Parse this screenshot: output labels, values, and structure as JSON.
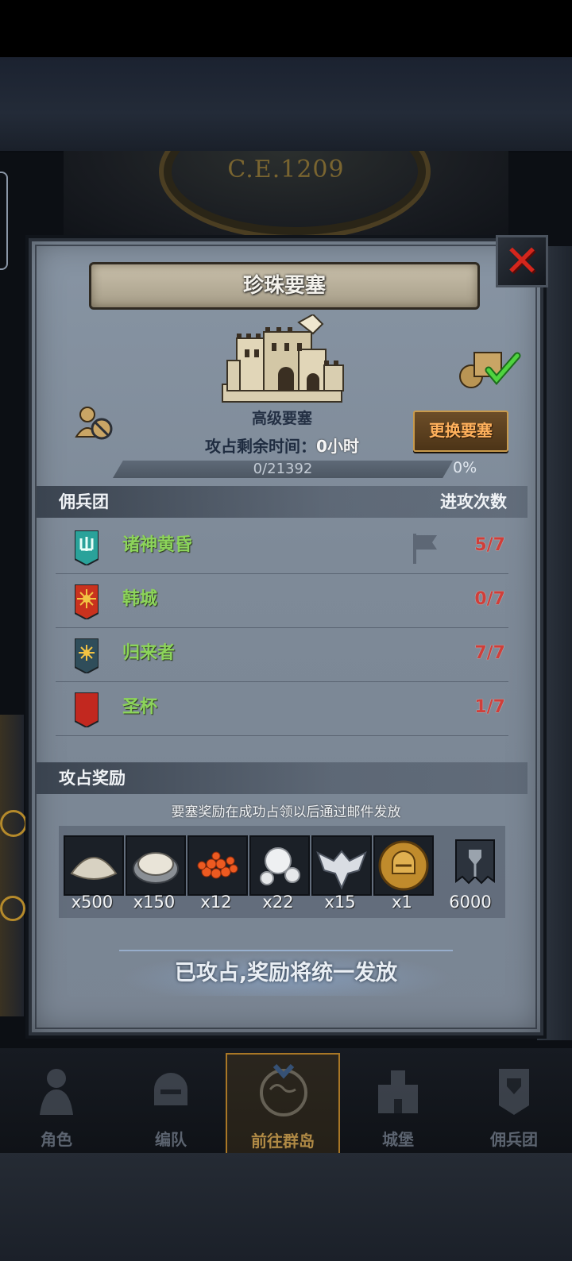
{
  "background": {
    "year_label": "C.E.1209"
  },
  "dialog": {
    "title": "珍珠要塞",
    "close_icon": "close-x-icon",
    "fortress_level": "高级要塞",
    "change_button": "更换要塞",
    "time_label": "攻占剩余时间：",
    "time_value": "0小时",
    "progress_text": "0/21392",
    "progress_percent": "0%",
    "progress_fraction": 0
  },
  "mercenaries": {
    "header_left": "佣兵团",
    "header_right": "进攻次数",
    "rows": [
      {
        "name": "诸神黄昏",
        "count": "5/7",
        "emblem_color": "#2aa29a",
        "has_flag": true
      },
      {
        "name": "韩城",
        "count": "0/7",
        "emblem_color": "#c9321e",
        "has_flag": false
      },
      {
        "name": "归来者",
        "count": "7/7",
        "emblem_color": "#2f4d5a",
        "has_flag": false
      },
      {
        "name": "圣杯",
        "count": "1/7",
        "emblem_color": "#c2281f",
        "has_flag": false
      }
    ]
  },
  "rewards": {
    "header": "攻占奖励",
    "note": "要塞奖励在成功占领以后通过邮件发放",
    "items": [
      {
        "icon": "salt-pile-icon",
        "qty": "x500"
      },
      {
        "icon": "oyster-icon",
        "qty": "x150"
      },
      {
        "icon": "fish-roe-icon",
        "qty": "x12"
      },
      {
        "icon": "pearls-icon",
        "qty": "x22"
      },
      {
        "icon": "winged-emblem-icon",
        "qty": "x15"
      },
      {
        "icon": "knight-helmet-coin-icon",
        "qty": "x1"
      },
      {
        "icon": "guild-banner-icon",
        "qty": "6000"
      }
    ]
  },
  "status_message": "已攻占,奖励将统一发放",
  "nav": {
    "items": [
      {
        "label": "角色",
        "icon": "knight-icon"
      },
      {
        "label": "编队",
        "icon": "helmet-icon"
      },
      {
        "label": "前往群岛",
        "icon": "world-map-icon"
      },
      {
        "label": "城堡",
        "icon": "castle-icon"
      },
      {
        "label": "佣兵团",
        "icon": "mercenary-icon"
      }
    ]
  }
}
